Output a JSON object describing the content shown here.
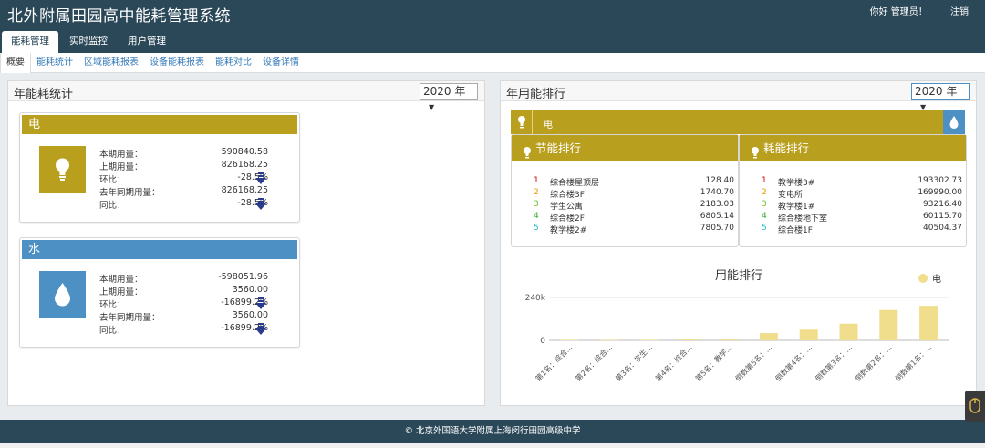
{
  "app": {
    "title": "北外附属田园高中能耗管理系统",
    "greeting": "你好 管理员！",
    "logout": "注销"
  },
  "main_tabs": [
    "能耗管理",
    "实时监控",
    "用户管理"
  ],
  "sub_tabs": [
    "概要",
    "能耗统计",
    "区域能耗报表",
    "设备能耗报表",
    "能耗对比",
    "设备详情"
  ],
  "left_panel": {
    "title": "年能耗统计",
    "year": "2020 年"
  },
  "right_panel": {
    "title": "年用能排行",
    "year": "2020 年"
  },
  "electric": {
    "title": "电",
    "color": "#b99f1e",
    "icon": "lightbulb-icon",
    "rows": [
      {
        "label": "本期用量：",
        "value": "590840.58"
      },
      {
        "label": "上期用量：",
        "value": "826168.25"
      },
      {
        "label": "环比：",
        "value": "-28.5%"
      },
      {
        "label": "去年同期用量：",
        "value": "826168.25"
      },
      {
        "label": "同比：",
        "value": "-28.5%"
      }
    ]
  },
  "water": {
    "title": "水",
    "color": "#4d90c4",
    "icon": "water-drop-icon",
    "rows": [
      {
        "label": "本期用量：",
        "value": "-598051.96"
      },
      {
        "label": "上期用量：",
        "value": "3560.00"
      },
      {
        "label": "环比：",
        "value": "-16899.2%"
      },
      {
        "label": "去年同期用量：",
        "value": "3560.00"
      },
      {
        "label": "同比：",
        "value": "-16899.2%"
      }
    ]
  },
  "ranking": {
    "bar_label": "电",
    "saving_title": "节能排行",
    "consuming_title": "耗能排行",
    "rank_colors": [
      "#cc0000",
      "#e89a00",
      "#6fbf2a",
      "#2fae2f",
      "#22b5c9"
    ],
    "saving": [
      {
        "rank": "1",
        "name": "综合楼屋顶层",
        "value": "128.40"
      },
      {
        "rank": "2",
        "name": "综合楼3F",
        "value": "1740.70"
      },
      {
        "rank": "3",
        "name": "学生公寓",
        "value": "2183.03"
      },
      {
        "rank": "4",
        "name": "综合楼2F",
        "value": "6805.14"
      },
      {
        "rank": "5",
        "name": "教学楼2#",
        "value": "7805.70"
      }
    ],
    "consuming": [
      {
        "rank": "1",
        "name": "教学楼3#",
        "value": "193302.73"
      },
      {
        "rank": "2",
        "name": "变电所",
        "value": "169990.00"
      },
      {
        "rank": "3",
        "name": "教学楼1#",
        "value": "93216.40"
      },
      {
        "rank": "4",
        "name": "综合楼地下室",
        "value": "60115.70"
      },
      {
        "rank": "5",
        "name": "综合楼1F",
        "value": "40504.37"
      }
    ]
  },
  "chart_data": {
    "type": "bar",
    "title": "用能排行",
    "legend": "电",
    "bar_color": "#f0de8c",
    "yticks": [
      "240k",
      "0"
    ],
    "ylim": [
      0,
      240000
    ],
    "categories": [
      "第1名：综合...",
      "第2名：综合...",
      "第3名：学生...",
      "第4名：综合...",
      "第5名：教学...",
      "倒数第5名：...",
      "倒数第4名：...",
      "倒数第3名：...",
      "倒数第2名：...",
      "倒数第1名：..."
    ],
    "values": [
      128.4,
      1740.7,
      2183.03,
      6805.14,
      7805.7,
      40504.37,
      60115.7,
      93216.4,
      169990.0,
      193302.73
    ]
  },
  "footer": "© 北京外国语大学附属上海闵行田园高级中学"
}
